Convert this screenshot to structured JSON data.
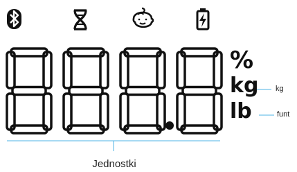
{
  "icons": [
    "bluetooth-icon",
    "dna-icon",
    "baby-icon",
    "battery-charging-icon"
  ],
  "display": {
    "digits": [
      "8",
      "8",
      "8",
      "8"
    ],
    "decimal_point": true,
    "units": {
      "percent": "%",
      "kg": "kg",
      "lb": "lb"
    }
  },
  "callouts": {
    "kg": "kg",
    "lb": "funt"
  },
  "caption": "Jednostki",
  "colors": {
    "ink": "#111111",
    "leader_line": "#4db3e6"
  }
}
